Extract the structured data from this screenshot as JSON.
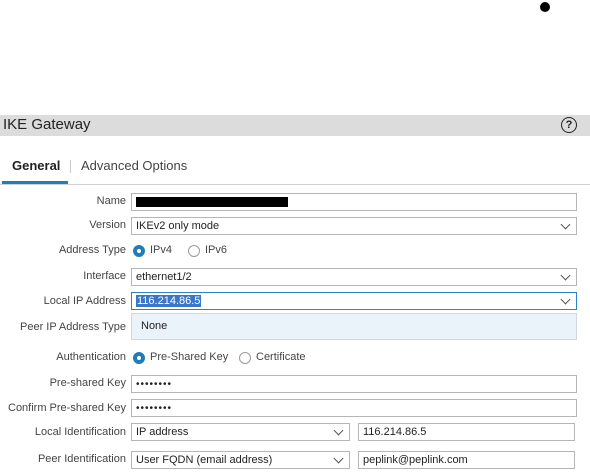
{
  "dialog": {
    "title": "IKE Gateway",
    "help_label": "?"
  },
  "tabs": [
    {
      "label": "General",
      "active": true
    },
    {
      "label": "Advanced Options",
      "active": false
    }
  ],
  "form": {
    "name": {
      "label": "Name",
      "value": ""
    },
    "version": {
      "label": "Version",
      "value": "IKEv2 only mode"
    },
    "address_type": {
      "label": "Address Type",
      "options": [
        "IPv4",
        "IPv6"
      ],
      "selected": "IPv4"
    },
    "interface": {
      "label": "Interface",
      "value": "ethernet1/2"
    },
    "local_ip": {
      "label": "Local IP Address",
      "value": "116.214.86.5"
    },
    "local_ip_dropdown": {
      "option": "None"
    },
    "peer_ip_type": {
      "label": "Peer IP Address Type"
    },
    "authentication": {
      "label": "Authentication",
      "options": [
        "Pre-Shared Key",
        "Certificate"
      ],
      "selected": "Pre-Shared Key"
    },
    "psk": {
      "label": "Pre-shared Key",
      "value": "••••••••"
    },
    "psk_confirm": {
      "label": "Confirm Pre-shared Key",
      "value": "••••••••"
    },
    "local_identification": {
      "label": "Local Identification",
      "type": "IP address",
      "value": "116.214.86.5"
    },
    "peer_identification": {
      "label": "Peer Identification",
      "type": "User FQDN (email address)",
      "value": "peplink@peplink.com"
    }
  },
  "colors": {
    "accent": "#1f7db8",
    "header_bg": "#dcdcdc",
    "selection": "#3b76c8",
    "dropdown_bg": "#eaf2fa"
  }
}
